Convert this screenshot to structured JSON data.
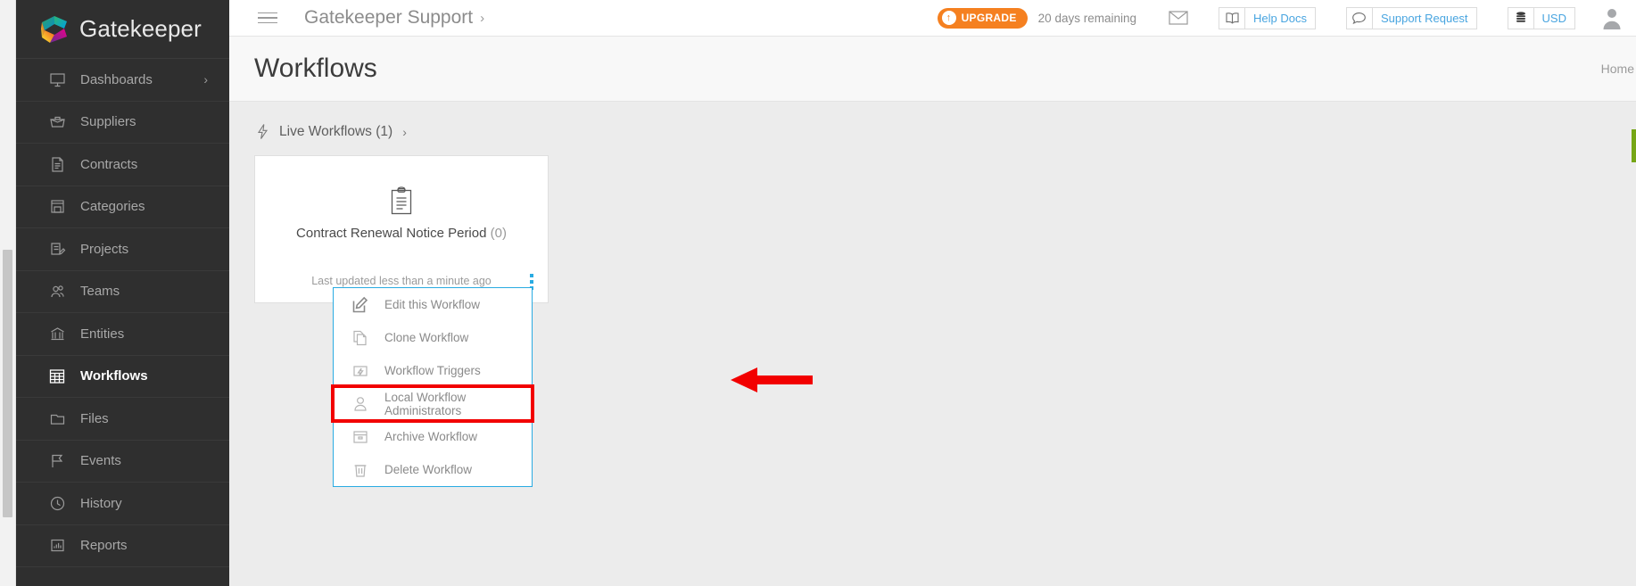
{
  "brand": {
    "name": "Gatekeeper",
    "logo_icon": "gatekeeper-logo"
  },
  "sidebar": {
    "items": [
      {
        "label": "Dashboards",
        "icon": "monitor-icon",
        "active": false,
        "chevron": "›"
      },
      {
        "label": "Suppliers",
        "icon": "briefcase-icon",
        "active": false
      },
      {
        "label": "Contracts",
        "icon": "document-icon",
        "active": false
      },
      {
        "label": "Categories",
        "icon": "archive-box-icon",
        "active": false
      },
      {
        "label": "Projects",
        "icon": "task-list-icon",
        "active": false
      },
      {
        "label": "Teams",
        "icon": "people-icon",
        "active": false
      },
      {
        "label": "Entities",
        "icon": "bank-icon",
        "active": false
      },
      {
        "label": "Workflows",
        "icon": "grid-workflow-icon",
        "active": true
      },
      {
        "label": "Files",
        "icon": "folder-icon",
        "active": false
      },
      {
        "label": "Events",
        "icon": "flag-icon",
        "active": false
      },
      {
        "label": "History",
        "icon": "clock-icon",
        "active": false
      },
      {
        "label": "Reports",
        "icon": "bar-chart-icon",
        "active": false
      }
    ]
  },
  "topbar": {
    "menu_icon": "hamburger-icon",
    "org_title": "Gatekeeper Support",
    "org_chevron": "›",
    "upgrade": {
      "label": "UPGRADE",
      "icon": "arrow-up-circle-icon"
    },
    "days_remaining": "20 days remaining",
    "mail_icon": "envelope-icon",
    "help_docs": {
      "label": "Help Docs",
      "icon": "book-icon"
    },
    "support_request": {
      "label": "Support Request",
      "icon": "speech-bubble-icon"
    },
    "currency": {
      "label": "USD",
      "icon": "coins-stack-icon"
    },
    "avatar_icon": "user-avatar-icon"
  },
  "page": {
    "title": "Workflows",
    "breadcrumb_home": "Home"
  },
  "section": {
    "label": "Live Workflows (1)",
    "icon": "lightning-bolt-icon",
    "chevron": "›"
  },
  "workflow_card": {
    "icon": "clipboard-icon",
    "name": "Contract Renewal Notice Period",
    "count": "(0)",
    "last_updated": "Last updated less than a minute ago",
    "kebab_icon": "kebab-menu-icon"
  },
  "dropdown": {
    "items": [
      {
        "label": "Edit this Workflow",
        "icon": "edit-pencil-icon",
        "highlighted": false
      },
      {
        "label": "Clone Workflow",
        "icon": "copy-icon",
        "highlighted": false
      },
      {
        "label": "Workflow Triggers",
        "icon": "trigger-bolt-icon",
        "highlighted": false
      },
      {
        "label": "Local Workflow Administrators",
        "icon": "user-person-icon",
        "highlighted": true
      },
      {
        "label": "Archive Workflow",
        "icon": "archive-icon",
        "highlighted": false
      },
      {
        "label": "Delete Workflow",
        "icon": "trash-bin-icon",
        "highlighted": false
      }
    ]
  },
  "annotation": {
    "arrow_icon": "red-pointer-arrow",
    "arrow_color": "#f20000",
    "highlight_color": "#f20000"
  },
  "colors": {
    "sidebar_bg": "#2f2f2f",
    "accent_blue": "#29abe2",
    "link_blue": "#49a5e0",
    "upgrade_orange": "#f58020",
    "green_tab": "#76a616",
    "content_bg": "#ececec"
  }
}
